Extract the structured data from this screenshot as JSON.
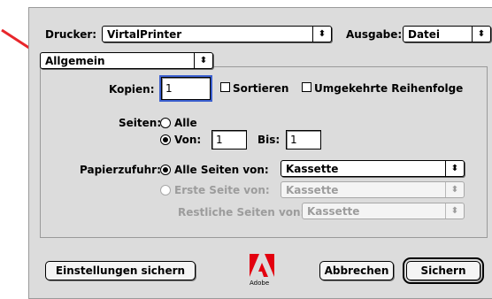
{
  "header": {
    "printer_label": "Drucker:",
    "printer_value": "VirtalPrinter",
    "output_label": "Ausgabe:",
    "output_value": "Datei"
  },
  "section_popup": {
    "value": "Allgemein"
  },
  "copies": {
    "label": "Kopien:",
    "value": "1",
    "collate_label": "Sortieren",
    "reverse_label": "Umgekehrte Reihenfolge"
  },
  "pages": {
    "label": "Seiten:",
    "all_label": "Alle",
    "from_label": "Von:",
    "from_value": "1",
    "to_label": "Bis:",
    "to_value": "1"
  },
  "paper_source": {
    "label": "Papierzufuhr:",
    "all_pages_label": "Alle Seiten von:",
    "all_pages_value": "Kassette",
    "first_page_label": "Erste Seite von:",
    "first_page_value": "Kassette",
    "remaining_label": "Restliche Seiten von:",
    "remaining_value": "Kassette"
  },
  "footer": {
    "save_settings_label": "Einstellungen sichern",
    "logo_text": "Adobe",
    "cancel_label": "Abbrechen",
    "save_label": "Sichern"
  },
  "colors": {
    "dialog_bg": "#dcdcdc",
    "focus_ring": "#3b5fcf",
    "annotation_arrow": "#e8262b",
    "adobe_red": "#e3000f"
  },
  "icons": [
    "popup-arrows-icon",
    "annotation-arrow-icon",
    "adobe-logo-icon"
  ]
}
